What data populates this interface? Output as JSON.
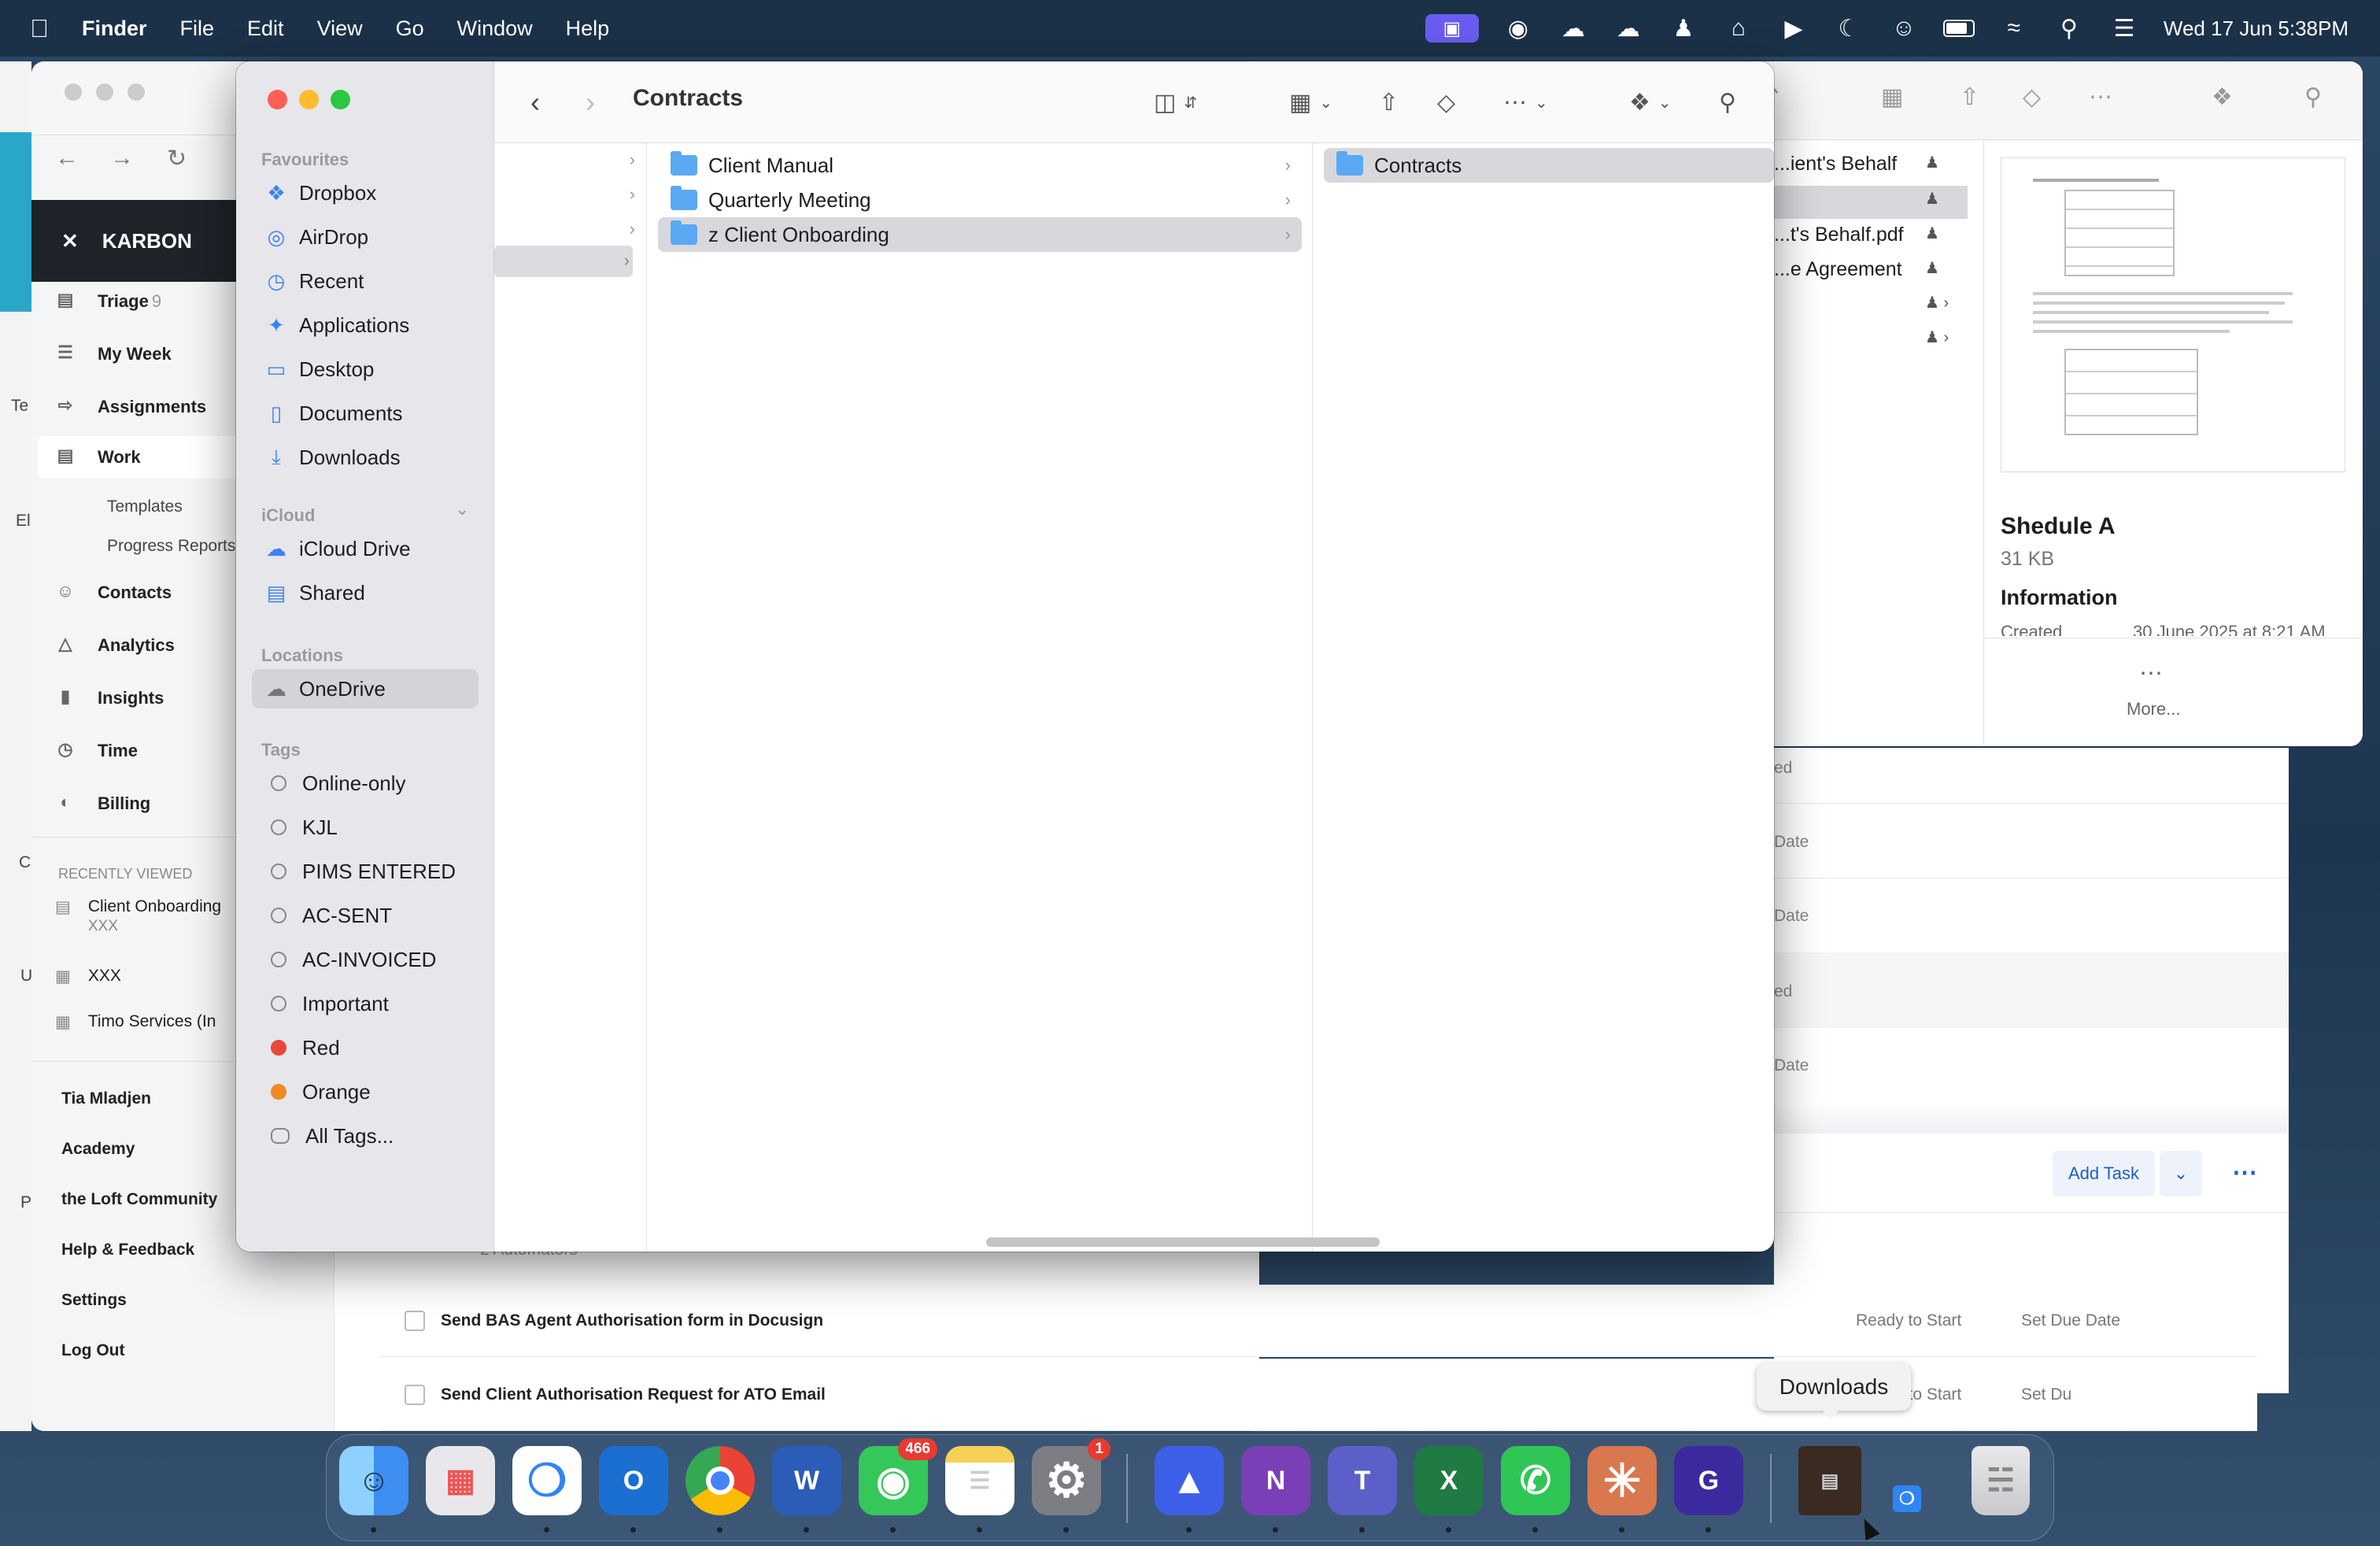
{
  "menubar": {
    "apple": "",
    "app_name": "Finder",
    "menus": [
      "File",
      "Edit",
      "View",
      "Go",
      "Window",
      "Help"
    ],
    "datetime": "Wed 17 Jun  5:38PM"
  },
  "karbon": {
    "brand": "KARBON",
    "nav": [
      "Triage",
      "My Week",
      "Assignments",
      "Work",
      "Contacts",
      "Analytics",
      "Insights",
      "Time",
      "Billing"
    ],
    "triage_count": "9",
    "work_sub": [
      "Templates",
      "Progress Reports"
    ],
    "recently_viewed_header": "RECENTLY VIEWED",
    "recent": [
      {
        "title": "Client Onboarding",
        "sub": "XXX"
      },
      {
        "title": "XXX",
        "sub": ""
      },
      {
        "title": "Timo Services (In",
        "sub": ""
      }
    ],
    "lower": [
      "Tia Mladjen",
      "Academy",
      "the Loft Community",
      "Help & Feedback",
      "Settings",
      "Log Out"
    ],
    "edge_letters": [
      "Te",
      "El",
      "C",
      "U",
      "P"
    ],
    "date_labels": [
      "ed",
      "Date",
      "Date",
      "ed",
      "Date"
    ],
    "add_task": "Add Task",
    "automators": "2 Automators",
    "tasks": [
      {
        "title": "Send BAS Agent Authorisation form in Docusign",
        "status": "Ready to Start",
        "due": "Set Due Date"
      },
      {
        "title": "Send Client Authorisation Request for ATO Email",
        "status": "Ready to Start",
        "due": "Set Du"
      }
    ]
  },
  "finder2": {
    "rows": [
      "...ient's Behalf",
      "",
      "...t's Behalf.pdf",
      "...e Agreement",
      "",
      ""
    ],
    "preview_title": "Shedule A",
    "preview_size": "31 KB",
    "info_label": "Information",
    "created_label": "Created",
    "created_value": "30 June 2025 at 8:21 AM",
    "more": "More..."
  },
  "finder": {
    "title": "Contracts",
    "sections": {
      "favourites": "Favourites",
      "icloud": "iCloud",
      "locations": "Locations",
      "tags": "Tags"
    },
    "favourites": [
      {
        "label": "Dropbox",
        "icon": "dropbox-icon"
      },
      {
        "label": "AirDrop",
        "icon": "airdrop-icon"
      },
      {
        "label": "Recent",
        "icon": "clock-icon"
      },
      {
        "label": "Applications",
        "icon": "applications-icon"
      },
      {
        "label": "Desktop",
        "icon": "desktop-icon"
      },
      {
        "label": "Documents",
        "icon": "document-icon"
      },
      {
        "label": "Downloads",
        "icon": "download-icon"
      }
    ],
    "icloud": [
      {
        "label": "iCloud Drive",
        "icon": "cloud-icon"
      },
      {
        "label": "Shared",
        "icon": "shared-folder-icon"
      }
    ],
    "locations": [
      {
        "label": "OneDrive",
        "icon": "cloud-icon"
      }
    ],
    "tags": [
      {
        "label": "Online-only",
        "color": ""
      },
      {
        "label": "KJL",
        "color": ""
      },
      {
        "label": "PIMS ENTERED",
        "color": ""
      },
      {
        "label": "AC-SENT",
        "color": ""
      },
      {
        "label": "AC-INVOICED",
        "color": ""
      },
      {
        "label": "Important",
        "color": ""
      },
      {
        "label": "Red",
        "color": "#e8483c"
      },
      {
        "label": "Orange",
        "color": "#f08a24"
      },
      {
        "label": "All Tags...",
        "color": ""
      }
    ],
    "column2": [
      "Client Manual",
      "Quarterly Meeting",
      "z Client Onboarding"
    ],
    "column3": [
      "Contracts"
    ]
  },
  "dock": {
    "tooltip": "Downloads",
    "apps": [
      {
        "name": "finder",
        "label": "",
        "color": "#3d8ef0"
      },
      {
        "name": "launchpad",
        "label": "",
        "color": "#8a8a95"
      },
      {
        "name": "safari",
        "label": "",
        "color": "#2f86f2"
      },
      {
        "name": "outlook",
        "label": "O",
        "color": "#1a6fd1"
      },
      {
        "name": "chrome",
        "label": "",
        "color": "#f3f3f3"
      },
      {
        "name": "word",
        "label": "W",
        "color": "#2b5cb8"
      },
      {
        "name": "messages",
        "label": "",
        "color": "#35c759",
        "badge": "466"
      },
      {
        "name": "notes",
        "label": "",
        "color": "#f6d155"
      },
      {
        "name": "system-settings",
        "label": "",
        "color": "#7d7d84",
        "badge": "1"
      },
      {
        "name": "nordvpn",
        "label": "",
        "color": "#3e5fe8"
      },
      {
        "name": "onenote",
        "label": "N",
        "color": "#7a3fb6"
      },
      {
        "name": "teams",
        "label": "T",
        "color": "#5b5fc7"
      },
      {
        "name": "excel",
        "label": "X",
        "color": "#1f7a44"
      },
      {
        "name": "whatsapp",
        "label": "",
        "color": "#2fc656"
      },
      {
        "name": "claude",
        "label": "",
        "color": "#d9774f"
      },
      {
        "name": "grammarly",
        "label": "G",
        "color": "#3b2a9e"
      }
    ]
  }
}
